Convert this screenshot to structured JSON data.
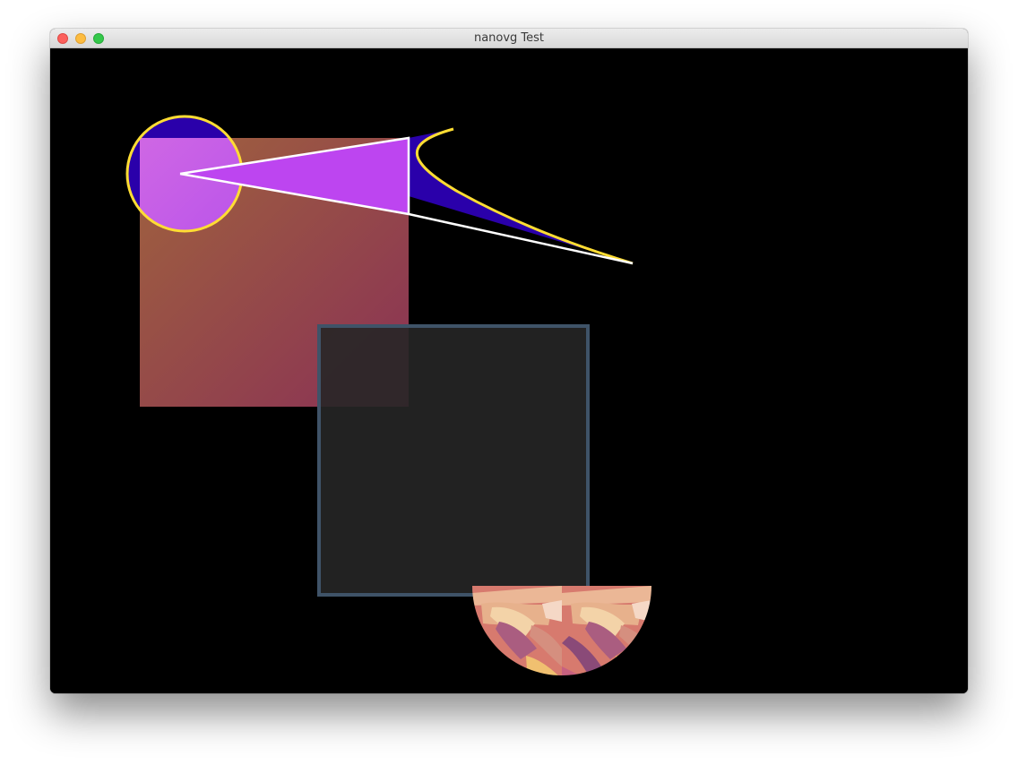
{
  "window": {
    "title": "nanovg Test",
    "controls": [
      "close",
      "minimize",
      "zoom"
    ]
  },
  "canvas": {
    "background": "#000000"
  },
  "colors": {
    "gradient_square_start": "#a0633d",
    "gradient_square_end": "#8a3155",
    "translucent_square_fill": "#262626",
    "translucent_square_stroke": "#3f5368",
    "circle_fill": "#cc66e6",
    "circle_blue": "#2a00aa",
    "triangle_fill": "#bd45f0",
    "curve_fill": "#2a00aa",
    "stroke_yellow": "#ffdd33",
    "stroke_white": "#ffffff"
  },
  "shapes": {
    "image_pattern_half_circle": "image-pattern"
  }
}
